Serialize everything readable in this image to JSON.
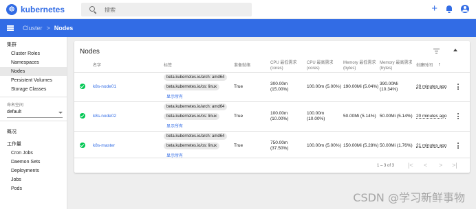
{
  "app": {
    "logo_text": "kubernetes",
    "logo_icon": "helm-wheel-icon"
  },
  "search": {
    "placeholder": "搜索"
  },
  "breadcrumb": {
    "parent": "Cluster",
    "separator": ">",
    "current": "Nodes"
  },
  "sidebar": {
    "cluster_header": "集群",
    "cluster_items": [
      "Cluster Roles",
      "Namespaces",
      "Nodes",
      "Persistent Volumes",
      "Storage Classes"
    ],
    "active_item": "Nodes",
    "namespace_label": "命名空间",
    "namespace_value": "default",
    "overview": "概况",
    "workloads_header": "工作量",
    "workload_items": [
      "Cron Jobs",
      "Daemon Sets",
      "Deployments",
      "Jobs",
      "Pods"
    ]
  },
  "card": {
    "title": "Nodes",
    "columns": [
      "名字",
      "标签",
      "准备就绪",
      "CPU 最低需求 (cores)",
      "CPU 最高需求 (cores)",
      "Memory 最低需求 (bytes)",
      "Memory 最高需求 (bytes)",
      "创建时间"
    ],
    "sort_indicator": "↑",
    "show_all": "显示所有",
    "rows": [
      {
        "name": "k8s-node01",
        "labels": [
          "beta.kubernetes.io/arch: amd64",
          "beta.kubernetes.io/os: linux"
        ],
        "ready": "True",
        "cpu_req": "300.00m",
        "cpu_req_pct": "(15.00%)",
        "cpu_lim": "100.00m (5.00%)",
        "mem_req": "190.00Mi (5.04%)",
        "mem_lim": "390.00Mi",
        "mem_lim_pct": "(10.34%)",
        "created": "20 minutes ago"
      },
      {
        "name": "k8s-node02",
        "labels": [
          "beta.kubernetes.io/arch: amd64",
          "beta.kubernetes.io/os: linux"
        ],
        "ready": "True",
        "cpu_req": "100.00m",
        "cpu_req_pct": "(10.00%)",
        "cpu_lim": "100.00m",
        "cpu_lim_pct": "(10.00%)",
        "mem_req": "50.00Mi (5.14%)",
        "mem_lim": "50.00Mi (5.14%)",
        "created": "20 minutes ago"
      },
      {
        "name": "k8s-master",
        "labels": [
          "beta.kubernetes.io/arch: amd64",
          "beta.kubernetes.io/os: linux"
        ],
        "ready": "True",
        "cpu_req": "750.00m",
        "cpu_req_pct": "(37.50%)",
        "cpu_lim": "100.00m (5.00%)",
        "mem_req": "150.00Mi (5.28%)",
        "mem_lim": "50.00Mi (1.76%)",
        "created": "21 minutes ago"
      }
    ],
    "pagination": {
      "range": "1 – 3 of 3",
      "first": "|<",
      "prev": "<",
      "next": ">",
      "last": ">|"
    }
  },
  "watermark": "CSDN @学习新鲜事物",
  "colors": {
    "primary": "#326ce5",
    "status_ok": "#00c752"
  }
}
